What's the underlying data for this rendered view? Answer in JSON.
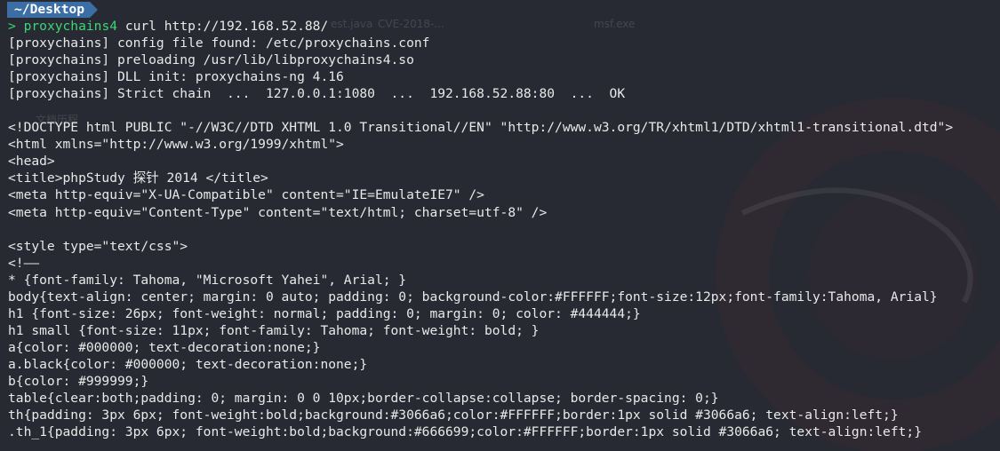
{
  "prompt": {
    "path": "~/Desktop",
    "arrow": ">",
    "command_name": "proxychains4",
    "command_args": " curl http://192.168.52.88/"
  },
  "background_ghost_labels": [
    "est.java",
    "CVE-2018-...",
    "msf.exe",
    "文档历程"
  ],
  "output_lines": [
    "[proxychains] config file found: /etc/proxychains.conf",
    "[proxychains] preloading /usr/lib/libproxychains4.so",
    "[proxychains] DLL init: proxychains-ng 4.16",
    "[proxychains] Strict chain  ...  127.0.0.1:1080  ...  192.168.52.88:80  ...  OK",
    "",
    "<!DOCTYPE html PUBLIC \"-//W3C//DTD XHTML 1.0 Transitional//EN\" \"http://www.w3.org/TR/xhtml1/DTD/xhtml1-transitional.dtd\">",
    "<html xmlns=\"http://www.w3.org/1999/xhtml\">",
    "<head>",
    "<title>phpStudy 探针 2014 </title>",
    "<meta http-equiv=\"X-UA-Compatible\" content=\"IE=EmulateIE7\" />",
    "<meta http-equiv=\"Content-Type\" content=\"text/html; charset=utf-8\" />",
    "",
    "<style type=\"text/css\">",
    "<!——",
    "* {font-family: Tahoma, \"Microsoft Yahei\", Arial; }",
    "body{text-align: center; margin: 0 auto; padding: 0; background-color:#FFFFFF;font-size:12px;font-family:Tahoma, Arial}",
    "h1 {font-size: 26px; font-weight: normal; padding: 0; margin: 0; color: #444444;}",
    "h1 small {font-size: 11px; font-family: Tahoma; font-weight: bold; }",
    "a{color: #000000; text-decoration:none;}",
    "a.black{color: #000000; text-decoration:none;}",
    "b{color: #999999;}",
    "table{clear:both;padding: 0; margin: 0 0 10px;border-collapse:collapse; border-spacing: 0;}",
    "th{padding: 3px 6px; font-weight:bold;background:#3066a6;color:#FFFFFF;border:1px solid #3066a6; text-align:left;}",
    ".th_1{padding: 3px 6px; font-weight:bold;background:#666699;color:#FFFFFF;border:1px solid #3066a6; text-align:left;}"
  ],
  "colors": {
    "background": "#272a32",
    "text": "#e9e9e9",
    "prompt_path_bg": "#3a6ea5",
    "command_green": "#3cd676"
  }
}
